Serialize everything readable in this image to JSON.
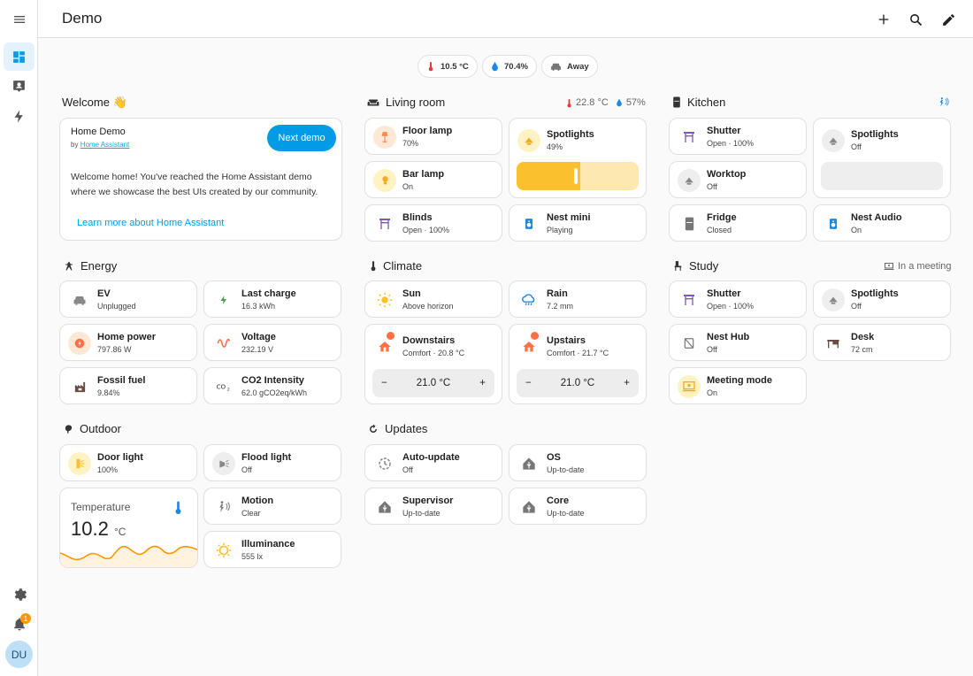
{
  "app": {
    "title": "Demo"
  },
  "badges": [
    {
      "value": "10.5 °C"
    },
    {
      "value": "70.4%"
    },
    {
      "value": "Away"
    }
  ],
  "sidebar": {
    "avatar_initials": "DU",
    "notification_count": "1"
  },
  "colors": {
    "accent": "#039be5",
    "warm": "#ff9800",
    "yellow": "#fbc02d",
    "purple": "#7e57c2",
    "blue": "#1e88e5",
    "green": "#43a047",
    "red": "#e53935"
  },
  "sections": {
    "welcome": {
      "title": "Welcome 👋",
      "demo_name": "Home Demo",
      "by_prefix": "by",
      "by_link": "Home Assistant",
      "next_button": "Next demo",
      "body": "Welcome home! You've reached the Home Assistant demo where we showcase the best UIs created by our community.",
      "learn_more": "Learn more about Home Assistant"
    },
    "living_room": {
      "title": "Living room",
      "temp": "22.8 °C",
      "humidity": "57%",
      "tiles": [
        {
          "name": "Floor lamp",
          "state": "70%",
          "icon": "floor-lamp-icon"
        },
        {
          "name": "Spotlights",
          "state": "49%",
          "icon": "spotlight-icon",
          "level": 0.49
        },
        {
          "name": "Bar lamp",
          "state": "On",
          "icon": "lightbulb-icon"
        },
        {
          "name": "Blinds",
          "state": "Open · 100%",
          "icon": "blinds-icon"
        },
        {
          "name": "Nest mini",
          "state": "Playing",
          "icon": "speaker-icon"
        }
      ]
    },
    "kitchen": {
      "title": "Kitchen",
      "tiles": [
        {
          "name": "Shutter",
          "state": "Open · 100%",
          "icon": "shutter-icon"
        },
        {
          "name": "Spotlights",
          "state": "Off",
          "icon": "spotlight-icon",
          "level": 0
        },
        {
          "name": "Worktop",
          "state": "Off",
          "icon": "spotlight-icon"
        },
        {
          "name": "Fridge",
          "state": "Closed",
          "icon": "fridge-icon"
        },
        {
          "name": "Nest Audio",
          "state": "On",
          "icon": "speaker-icon"
        }
      ]
    },
    "energy": {
      "title": "Energy",
      "tiles": [
        {
          "name": "EV",
          "state": "Unplugged",
          "icon": "car-icon"
        },
        {
          "name": "Last charge",
          "state": "16.3 kWh",
          "icon": "flash-icon"
        },
        {
          "name": "Home power",
          "state": "797.86 W",
          "icon": "home-power-icon"
        },
        {
          "name": "Voltage",
          "state": "232.19 V",
          "icon": "sine-wave-icon"
        },
        {
          "name": "Fossil fuel",
          "state": "9.84%",
          "icon": "factory-icon"
        },
        {
          "name": "CO2 Intensity",
          "state": "62.0 gCO2eq/kWh",
          "icon": "co2-icon"
        }
      ]
    },
    "climate": {
      "title": "Climate",
      "tiles": [
        {
          "name": "Sun",
          "state": "Above horizon",
          "icon": "sun-icon"
        },
        {
          "name": "Rain",
          "state": "7.2 mm",
          "icon": "rain-icon"
        }
      ],
      "thermostats": [
        {
          "name": "Downstairs",
          "state": "Comfort · 20.8 °C",
          "target": "21.0 °C",
          "minus": "−",
          "plus": "+"
        },
        {
          "name": "Upstairs",
          "state": "Comfort · 21.7 °C",
          "target": "21.0 °C",
          "minus": "−",
          "plus": "+"
        }
      ]
    },
    "study": {
      "title": "Study",
      "extra": "In a meeting",
      "tiles": [
        {
          "name": "Shutter",
          "state": "Open · 100%",
          "icon": "shutter-icon"
        },
        {
          "name": "Spotlights",
          "state": "Off",
          "icon": "spotlight-icon"
        },
        {
          "name": "Nest Hub",
          "state": "Off",
          "icon": "nest-hub-icon"
        },
        {
          "name": "Desk",
          "state": "72 cm",
          "icon": "desk-icon"
        },
        {
          "name": "Meeting mode",
          "state": "On",
          "icon": "meeting-icon"
        }
      ]
    },
    "outdoor": {
      "title": "Outdoor",
      "tiles": [
        {
          "name": "Door light",
          "state": "100%",
          "icon": "door-light-icon"
        },
        {
          "name": "Flood light",
          "state": "Off",
          "icon": "flood-light-icon"
        },
        {
          "name": "Motion",
          "state": "Clear",
          "icon": "motion-icon"
        },
        {
          "name": "Illuminance",
          "state": "555 lx",
          "icon": "brightness-icon"
        }
      ],
      "temperature": {
        "label": "Temperature",
        "value": "10.2",
        "unit": "°C"
      }
    },
    "updates": {
      "title": "Updates",
      "tiles": [
        {
          "name": "Auto-update",
          "state": "Off",
          "icon": "auto-update-icon"
        },
        {
          "name": "OS",
          "state": "Up-to-date",
          "icon": "ha-logo-icon"
        },
        {
          "name": "Supervisor",
          "state": "Up-to-date",
          "icon": "ha-logo-icon"
        },
        {
          "name": "Core",
          "state": "Up-to-date",
          "icon": "ha-logo-icon"
        }
      ]
    }
  }
}
